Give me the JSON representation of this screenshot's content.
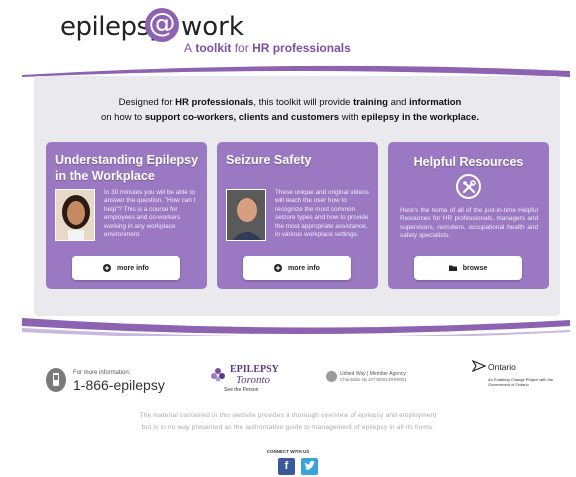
{
  "header": {
    "logo_left": "epilepsy",
    "logo_at": "@",
    "logo_right": "work",
    "tagline_a": "A",
    "tagline_b": "toolkit",
    "tagline_c": "for",
    "tagline_d": "HR professionals"
  },
  "intro": {
    "p1": "Designed for ",
    "b1": "HR professionals",
    "p2": ", this toolkit will provide ",
    "b2": "training",
    "p3": " and ",
    "b3": "information",
    "p4": "on how to ",
    "b4": "support co-workers, clients and customers",
    "p5": " with ",
    "b5": "epilepsy in the workplace."
  },
  "cards": [
    {
      "title_line1": "Understanding Epilepsy",
      "title_line2": "in the Workplace",
      "body": "In 30 minutes you will be able to answer the question, \"How can I help\"? This is a course for employees and co-workers working in any workplace environment.",
      "button": "more info",
      "icon": "plus-circle-icon"
    },
    {
      "title_line1": "Seizure Safety",
      "body": "These unique and original videos will teach the user how to recognize the most common seizure types and how to provide the most appropriate assistance, in various workplace settings.",
      "button": "more info",
      "icon": "plus-circle-icon"
    },
    {
      "title_line1": "Helpful Resources",
      "body": "Here's the home of all of the just-in-time Helpful Resources for HR professionals, managers and supervisors, recruiters, occupational health and safety specialists.",
      "button": "browse",
      "icon": "folder-icon"
    }
  ],
  "footer": {
    "phone_label": "For more information:",
    "phone_number": "1-866-epilepsy",
    "et_name": "EPILEPSY",
    "et_city": "Toronto",
    "et_sub": "See the Person",
    "uw_line1": "United Way | Member Agency",
    "uw_line2": "Charitable № 107306812RR0001",
    "on_name": "Ontario",
    "on_sub": "An Enabling Change Project with the Government of Ontario",
    "disclaimer_1": "The material contained in this website provides a thorough overview of epilepsy and employment",
    "disclaimer_2": "but is in no way presented as the authoritative guide to management of epilepsy in all its forms.",
    "connect": "CONNECT WITH US",
    "facebook": "f",
    "twitter": "t"
  },
  "colors": {
    "purple": "#9a78c2",
    "brand": "#8d62b0",
    "panel": "#e9e9ee",
    "facebook": "#3b5998",
    "twitter": "#3aa3dc"
  }
}
